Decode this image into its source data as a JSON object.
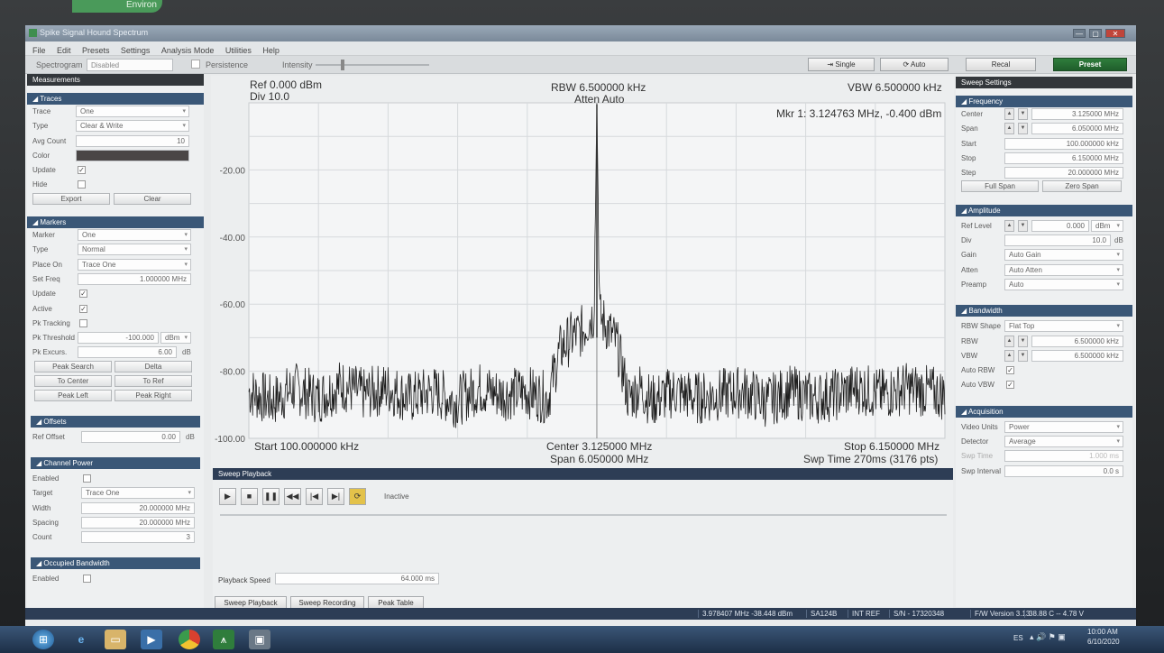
{
  "bezel_label": "Environ",
  "window": {
    "title": "Spike Signal Hound Spectrum",
    "buttons": [
      "—",
      "▢",
      "✕"
    ]
  },
  "menu": [
    "File",
    "Edit",
    "Presets",
    "Settings",
    "Analysis Mode",
    "Utilities",
    "Help"
  ],
  "toolbar": {
    "spectrogram_label": "Spectrogram",
    "spectrogram_value": "Disabled",
    "persistence_label": "Persistence",
    "intensity_label": "Intensity",
    "single_label": "Single",
    "auto_label": "Auto",
    "recal_label": "Recal",
    "preset_label": "Preset"
  },
  "left": {
    "measurements_title": "Measurements",
    "traces": {
      "title": "Traces",
      "trace_label": "Trace",
      "trace_value": "One",
      "type_label": "Type",
      "type_value": "Clear & Write",
      "avg_label": "Avg Count",
      "avg_value": "10",
      "color_label": "Color",
      "update_label": "Update",
      "hide_label": "Hide",
      "export_label": "Export",
      "clear_label": "Clear"
    },
    "markers": {
      "title": "Markers",
      "marker_label": "Marker",
      "marker_value": "One",
      "type_label": "Type",
      "type_value": "Normal",
      "place_label": "Place On",
      "place_value": "Trace One",
      "setfreq_label": "Set Freq",
      "setfreq_value": "1.000000 MHz",
      "update_label": "Update",
      "active_label": "Active",
      "pktrack_label": "Pk Tracking",
      "pkthresh_label": "Pk Threshold",
      "pkthresh_value": "-100.000",
      "pkthresh_unit": "dBm",
      "pkexcurs_label": "Pk Excurs.",
      "pkexcurs_value": "6.00",
      "pkexcurs_unit": "dB",
      "peak_search": "Peak Search",
      "delta": "Delta",
      "to_center": "To Center",
      "to_ref": "To Ref",
      "peak_left": "Peak Left",
      "peak_right": "Peak Right"
    },
    "offsets": {
      "title": "Offsets",
      "ref_label": "Ref Offset",
      "ref_value": "0.00",
      "ref_unit": "dB"
    },
    "channel_power": {
      "title": "Channel Power",
      "enabled_label": "Enabled",
      "target_label": "Target",
      "target_value": "Trace One",
      "width_label": "Width",
      "width_value": "20.000000 MHz",
      "spacing_label": "Spacing",
      "spacing_value": "20.000000 MHz",
      "count_label": "Count",
      "count_value": "3"
    },
    "occupied": {
      "title": "Occupied Bandwidth",
      "enabled_label": "Enabled"
    }
  },
  "right": {
    "title": "Sweep Settings",
    "frequency": {
      "title": "Frequency",
      "center_label": "Center",
      "center_value": "3.125000 MHz",
      "span_label": "Span",
      "span_value": "6.050000 MHz",
      "start_label": "Start",
      "start_value": "100.000000 kHz",
      "stop_label": "Stop",
      "stop_value": "6.150000 MHz",
      "step_label": "Step",
      "step_value": "20.000000 MHz",
      "full_span": "Full Span",
      "zero_span": "Zero Span"
    },
    "amplitude": {
      "title": "Amplitude",
      "ref_label": "Ref Level",
      "ref_value": "0.000",
      "ref_unit": "dBm",
      "div_label": "Div",
      "div_value": "10.0",
      "div_unit": "dB",
      "gain_label": "Gain",
      "gain_value": "Auto Gain",
      "atten_label": "Atten",
      "atten_value": "Auto Atten",
      "preamp_label": "Preamp",
      "preamp_value": "Auto"
    },
    "bandwidth": {
      "title": "Bandwidth",
      "shape_label": "RBW Shape",
      "shape_value": "Flat Top",
      "rbw_label": "RBW",
      "rbw_value": "6.500000 kHz",
      "vbw_label": "VBW",
      "vbw_value": "6.500000 kHz",
      "autorbw_label": "Auto RBW",
      "autovbw_label": "Auto VBW"
    },
    "acquisition": {
      "title": "Acquisition",
      "units_label": "Video Units",
      "units_value": "Power",
      "detector_label": "Detector",
      "detector_value": "Average",
      "swptime_label": "Swp Time",
      "swptime_value": "1.000 ms",
      "swpint_label": "Swp Interval",
      "swpint_value": "0.0 s"
    }
  },
  "plot": {
    "ref": "Ref 0.000 dBm",
    "div": "Div 10.0",
    "rbw": "RBW 6.500000 kHz",
    "atten": "Atten Auto",
    "vbw": "VBW 6.500000 kHz",
    "marker": "Mkr 1: 3.124763 MHz, -0.400 dBm",
    "start": "Start 100.000000 kHz",
    "center": "Center 3.125000 MHz",
    "span": "Span 6.050000 MHz",
    "stop": "Stop 6.150000 MHz",
    "swptime": "Swp Time 270ms (3176 pts)",
    "y_ticks": [
      "-20.00",
      "-40.00",
      "-60.00",
      "-80.00",
      "-100.00"
    ]
  },
  "chart_data": {
    "type": "line",
    "title": "",
    "xlabel": "",
    "ylabel": "",
    "x_range_mhz": [
      0.1,
      6.15
    ],
    "ylim": [
      -100,
      0
    ],
    "y_ticks": [
      -20,
      -40,
      -60,
      -80,
      -100
    ],
    "grid": true,
    "marker": {
      "freq_mhz": 3.124763,
      "level_dbm": -0.4
    },
    "series": [
      {
        "x": [
          0.1,
          0.3,
          0.5,
          0.7,
          0.9,
          1.1,
          1.3,
          1.5,
          1.7,
          1.9,
          2.1,
          2.3,
          2.5,
          2.7,
          2.8,
          2.9,
          3.0,
          3.05,
          3.1,
          3.124763,
          3.15,
          3.2,
          3.3,
          3.4,
          3.5,
          3.6,
          3.8,
          4.0,
          4.2,
          4.4,
          4.6,
          4.8,
          5.0,
          5.2,
          5.4,
          5.6,
          5.8,
          6.0,
          6.15
        ],
        "values": [
          -86,
          -89,
          -85,
          -88,
          -84,
          -87,
          -85,
          -88,
          -86,
          -89,
          -85,
          -87,
          -86,
          -88,
          -74,
          -70,
          -68,
          -65,
          -63,
          -0.4,
          -64,
          -66,
          -72,
          -88,
          -85,
          -89,
          -86,
          -88,
          -87,
          -86,
          -89,
          -86,
          -88,
          -87,
          -85,
          -87,
          -85,
          -86,
          -87
        ]
      }
    ]
  },
  "playback": {
    "title": "Sweep Playback",
    "status": "Inactive",
    "speed_label": "Playback Speed",
    "speed_value": "64.000 ms",
    "tabs": [
      "Sweep Playback",
      "Sweep Recording",
      "Peak Table"
    ]
  },
  "status": [
    "3.978407 MHz -38.448 dBm",
    "SA124B",
    "INT REF",
    "S/N - 17320348",
    "F/W Version 3.13",
    "38.88 C -- 4.78 V"
  ],
  "taskbar": {
    "time": "10:00 AM",
    "date": "6/10/2020",
    "lang": "ES"
  }
}
